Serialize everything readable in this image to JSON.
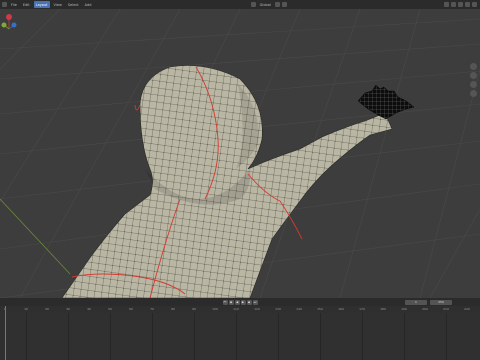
{
  "header": {
    "menu": [
      "File",
      "Edit",
      "Render",
      "Window",
      "Help"
    ],
    "workspace_tabs": [
      "Layout",
      "Modeling",
      "Sculpting",
      "UV Editing"
    ],
    "viewport_menu": [
      "View",
      "Select",
      "Add",
      "Mesh"
    ],
    "orientation": "Global"
  },
  "timeline": {
    "start_label": "1",
    "end_label": "250",
    "ticks": [
      "0",
      "10",
      "20",
      "30",
      "40",
      "50",
      "60",
      "70",
      "80",
      "90",
      "100",
      "110",
      "120",
      "130",
      "140",
      "150",
      "160",
      "170",
      "180",
      "190",
      "200",
      "210",
      "220"
    ]
  },
  "colors": {
    "seam": "#d43a2f",
    "mesh_fill": "#b9b6a4",
    "wire": "#2a2a24",
    "grid": "#4a4a4a",
    "accent": "#4772b3"
  }
}
